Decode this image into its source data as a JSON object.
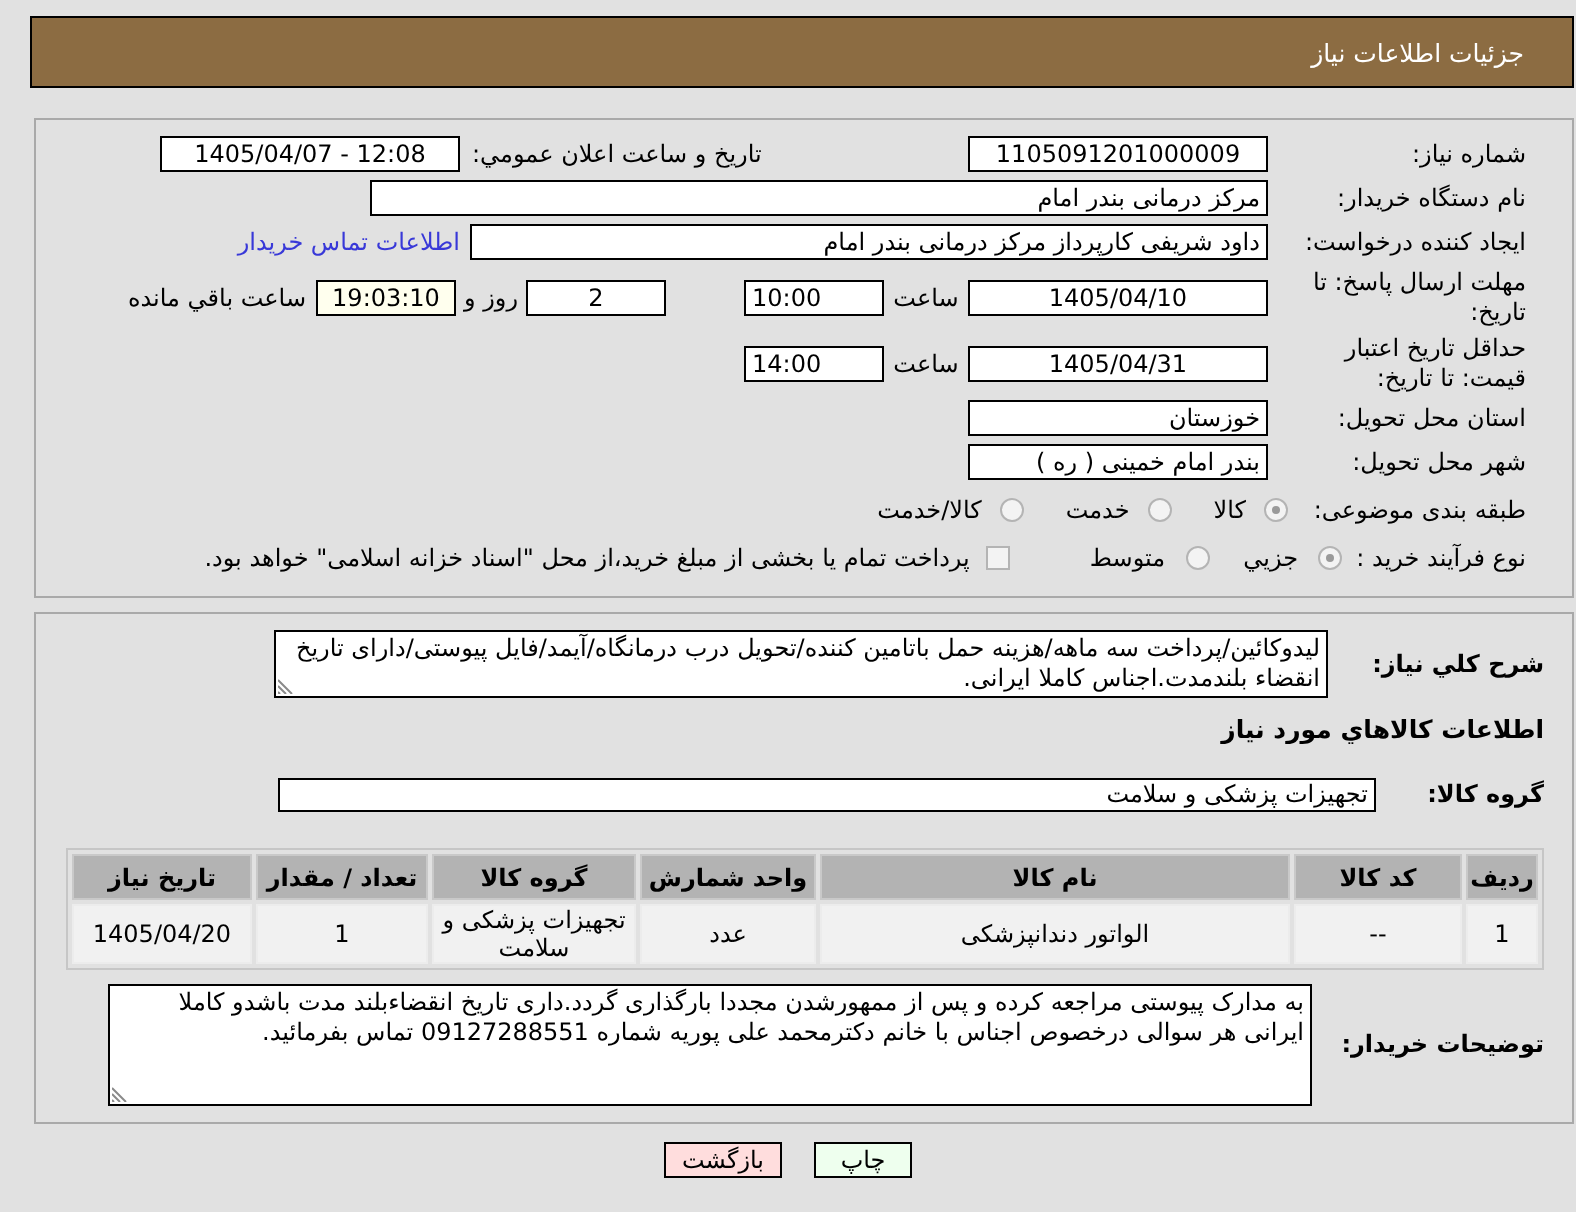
{
  "header": {
    "title": "جزئیات اطلاعات نیاز"
  },
  "need_number": {
    "label": "شماره نیاز:",
    "value": "1105091201000009"
  },
  "announcement": {
    "label": "تاریخ و ساعت اعلان عمومي:",
    "value": "1405/04/07 - 12:08"
  },
  "buyer_name": {
    "label": "نام دستگاه خریدار:",
    "value": "مرکز درمانی بندر امام"
  },
  "requester": {
    "label": "ایجاد کننده درخواست:",
    "value": "داود شریفی کارپرداز مرکز درمانی بندر امام",
    "contact_link": "اطلاعات تماس خریدار"
  },
  "reply_deadline": {
    "label": "مهلت ارسال پاسخ: تا تاریخ:",
    "date": "1405/04/10",
    "time_label": "ساعت",
    "time": "10:00",
    "days": "2",
    "days_label": "روز و",
    "remaining": "19:03:10",
    "remaining_label": "ساعت باقي مانده"
  },
  "price_validity": {
    "label": "حداقل تاریخ اعتبار قیمت: تا تاریخ:",
    "date": "1405/04/31",
    "time_label": "ساعت",
    "time": "14:00"
  },
  "delivery_province": {
    "label": "استان محل تحویل:",
    "value": "خوزستان"
  },
  "delivery_city": {
    "label": "شهر محل تحویل:",
    "value": "بندر امام خمینی ( ره )"
  },
  "subject_category": {
    "label": "طبقه بندی موضوعی:",
    "options": [
      {
        "label": "کالا",
        "selected": true
      },
      {
        "label": "خدمت",
        "selected": false
      },
      {
        "label": "کالا/خدمت",
        "selected": false
      }
    ]
  },
  "purchase_process": {
    "label": "نوع فرآیند خرید :",
    "options": [
      {
        "label": "جزيي",
        "selected": true
      },
      {
        "label": "متوسط",
        "selected": false
      }
    ],
    "treasury_payment": {
      "label": "پرداخت تمام یا بخشی از مبلغ خرید،از محل \"اسناد خزانه اسلامی\" خواهد بود.",
      "checked": false
    }
  },
  "description": {
    "label": "شرح کلي نیاز:",
    "value": "لیدوکائین/پرداخت سه ماهه/هزینه حمل باتامین کننده/تحویل درب درمانگاه/آیمد/فایل پیوستی/دارای تاریخ انقضاء بلندمدت.اجناس کاملا ایرانی."
  },
  "goods_section": {
    "title": "اطلاعات کالاهاي مورد نیاز",
    "group_label": "گروه کالا:",
    "group_value": "تجهیزات پزشکی و سلامت"
  },
  "goods_table": {
    "columns": [
      "ردیف",
      "کد کالا",
      "نام کالا",
      "واحد شمارش",
      "گروه کالا",
      "تعداد / مقدار",
      "تاریخ نیاز"
    ],
    "rows": [
      [
        "1",
        "--",
        "الواتور دندانپزشکی",
        "عدد",
        "تجهیزات پزشکی و سلامت",
        "1",
        "1405/04/20"
      ]
    ]
  },
  "buyer_notes": {
    "label": "توضیحات خریدار:",
    "value": "به مدارک پیوستی مراجعه کرده و پس از ممهورشدن مجددا بارگذاری گردد.داری تاریخ انقضاءبلند مدت باشدو کاملا ایرانی هر سوالی درخصوص اجناس با خانم دکترمحمد علی پوریه شماره 09127288551 تماس بفرمائید."
  },
  "buttons": [
    {
      "label": "چاپ",
      "kind": "print"
    },
    {
      "label": "بازگشت",
      "kind": "back"
    }
  ]
}
